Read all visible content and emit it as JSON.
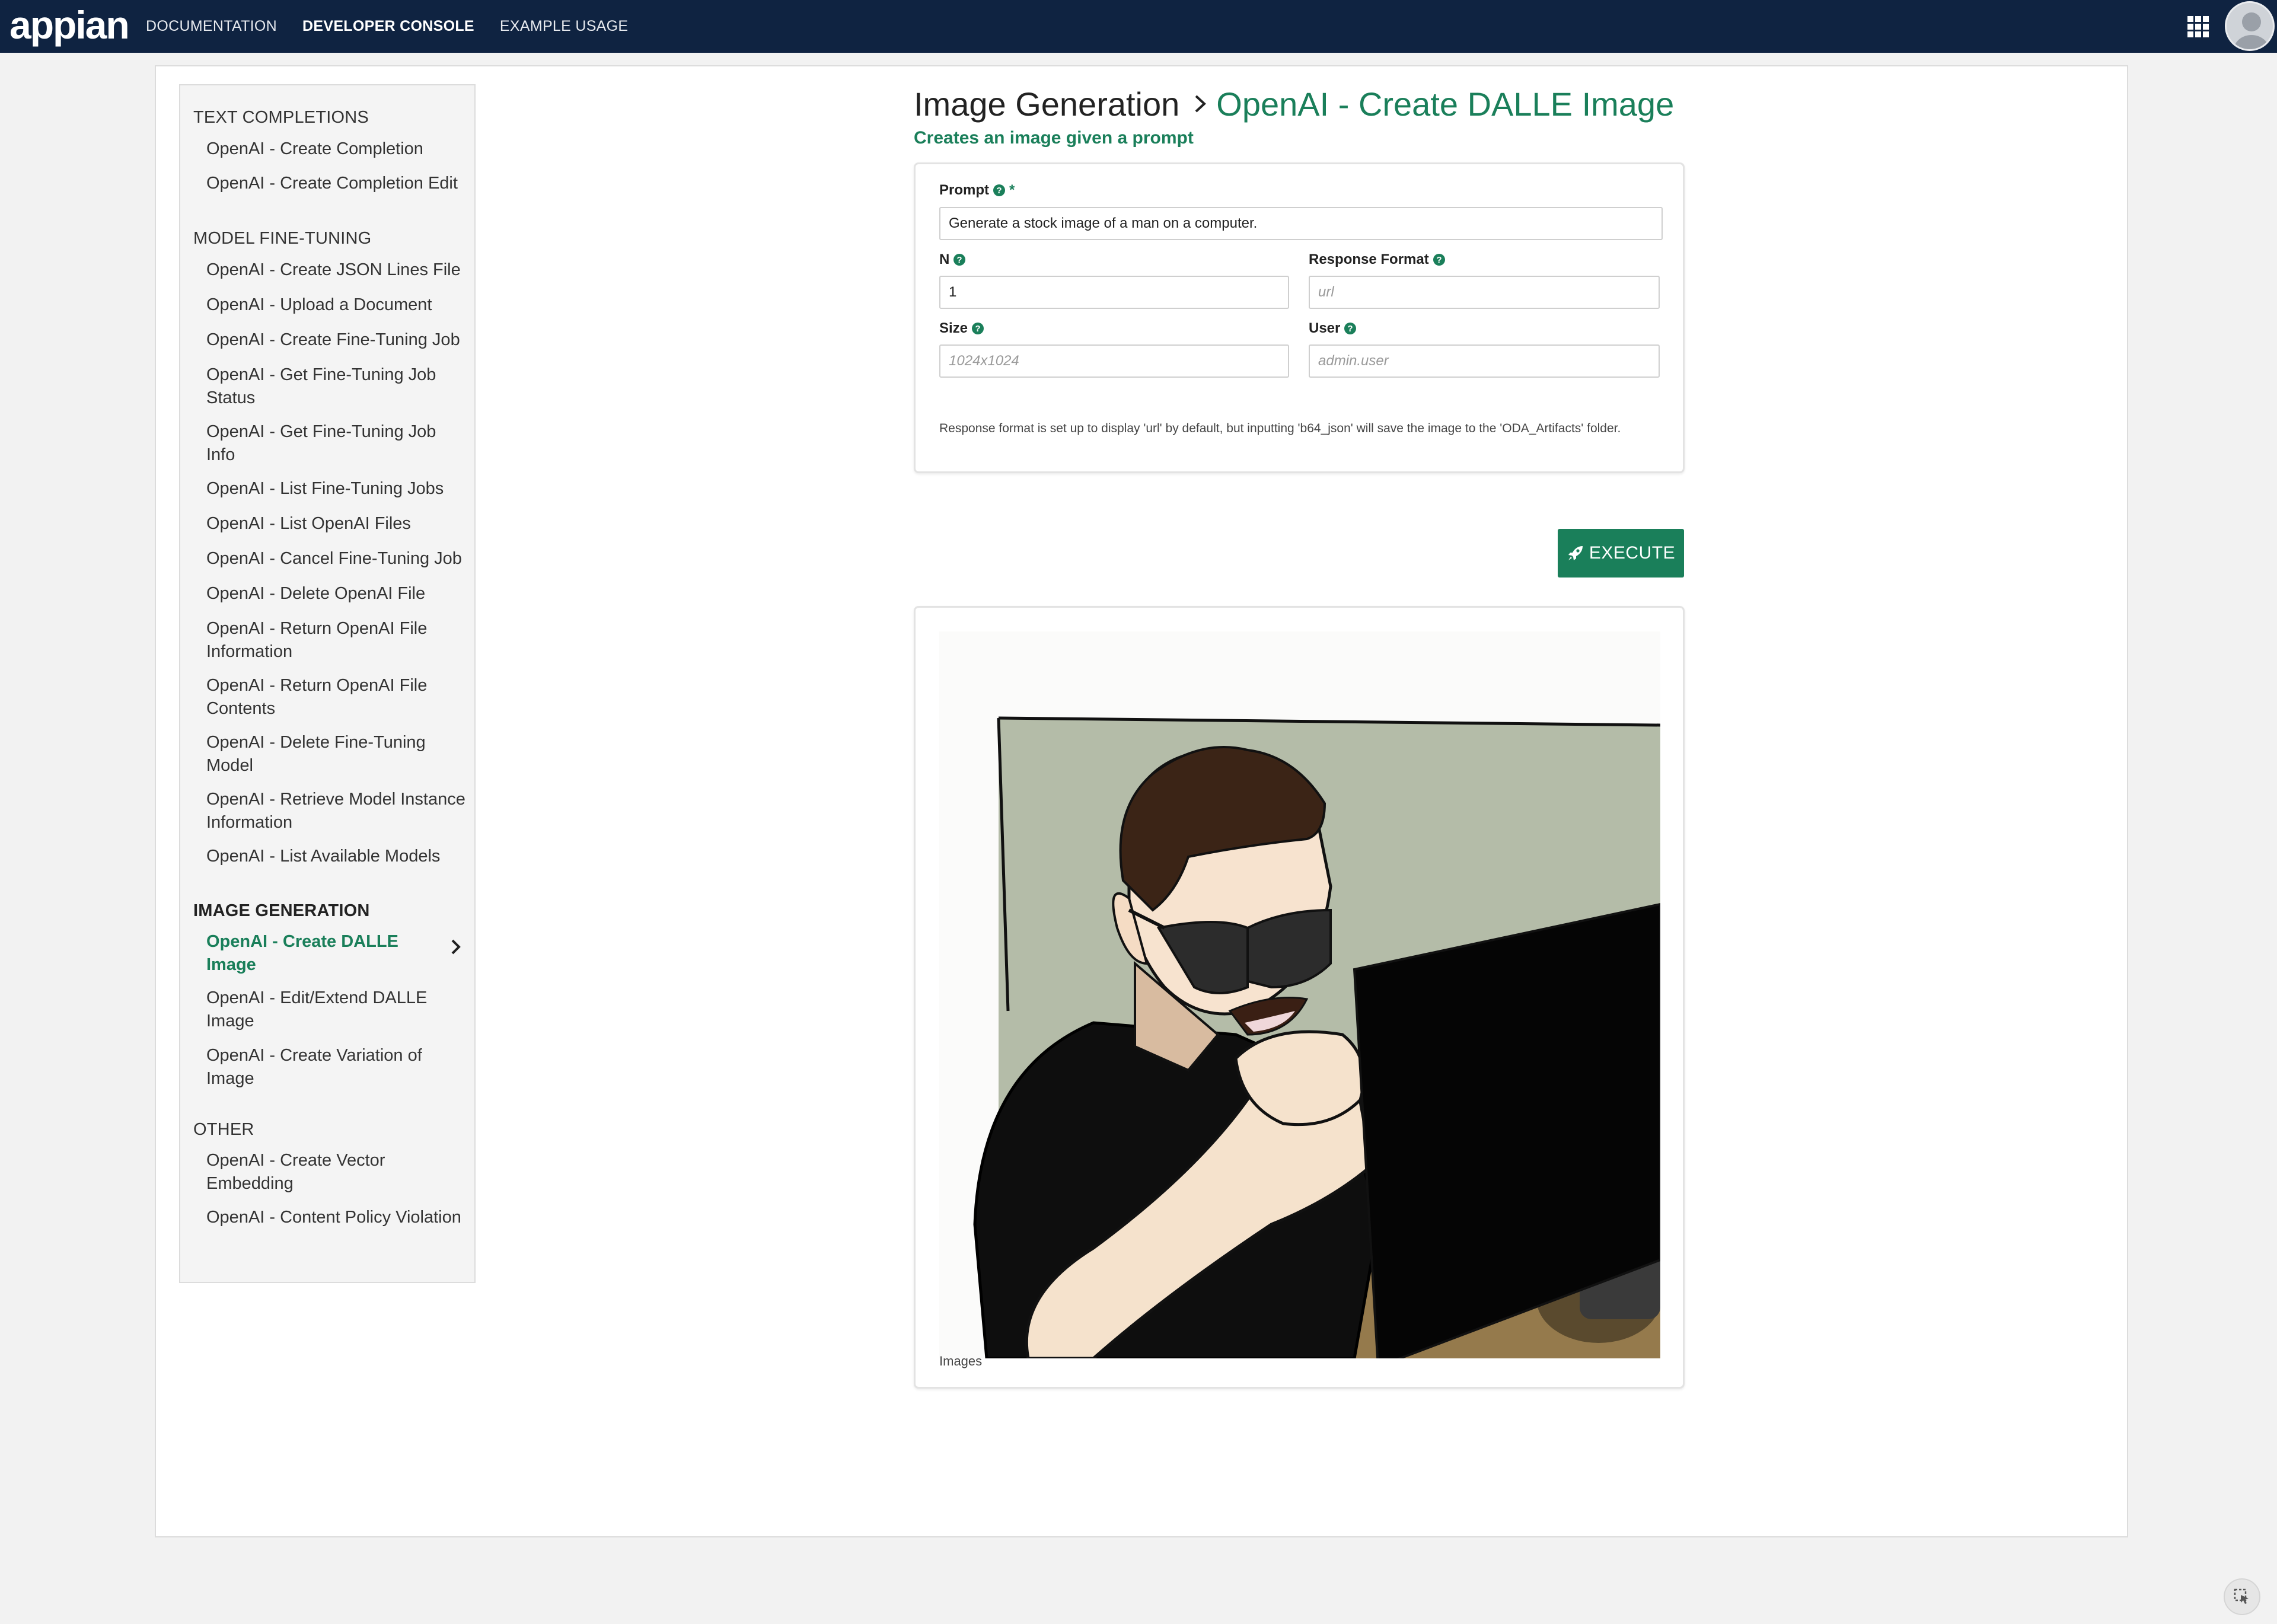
{
  "app": {
    "logo": "appian",
    "nav": [
      {
        "label": "DOCUMENTATION"
      },
      {
        "label": "DEVELOPER CONSOLE"
      },
      {
        "label": "EXAMPLE USAGE"
      }
    ]
  },
  "sidebar": {
    "sections": [
      {
        "header": "TEXT COMPLETIONS",
        "items": [
          "OpenAI - Create Completion",
          "OpenAI - Create Completion Edit"
        ]
      },
      {
        "header": "MODEL FINE-TUNING",
        "items": [
          "OpenAI - Create JSON Lines File",
          "OpenAI - Upload a Document",
          "OpenAI - Create Fine-Tuning Job",
          "OpenAI - Get Fine-Tuning Job Status",
          "OpenAI - Get Fine-Tuning Job Info",
          "OpenAI - List Fine-Tuning Jobs",
          "OpenAI - List OpenAI Files",
          "OpenAI - Cancel Fine-Tuning Job",
          "OpenAI - Delete OpenAI File",
          "OpenAI - Return OpenAI File Information",
          "OpenAI - Return OpenAI File Contents",
          "OpenAI - Delete Fine-Tuning Model",
          "OpenAI - Retrieve Model Instance Information",
          "OpenAI - List Available Models"
        ]
      },
      {
        "header": "IMAGE GENERATION",
        "items": [
          "OpenAI - Create DALLE Image",
          "OpenAI - Edit/Extend DALLE Image",
          "OpenAI - Create Variation of Image"
        ]
      },
      {
        "header": "OTHER",
        "items": [
          "OpenAI - Create Vector Embedding",
          "OpenAI - Content Policy Violation"
        ]
      }
    ]
  },
  "content": {
    "breadcrumb_parent": "Image Generation",
    "title": "OpenAI - Create DALLE Image",
    "subtitle": "Creates an image given a prompt",
    "form": {
      "prompt_label": "Prompt",
      "prompt_required": "*",
      "prompt_value": "Generate a stock image of a man on a computer.",
      "n_label": "N",
      "n_value": "1",
      "response_format_label": "Response Format",
      "response_format_placeholder": "url",
      "size_label": "Size",
      "size_placeholder": "1024x1024",
      "user_label": "User",
      "user_placeholder": "admin.user",
      "note": "Response format is set up to display 'url' by default, but inputting 'b64_json' will save the image to the 'ODA_Artifacts' folder."
    },
    "execute_label": "EXECUTE",
    "image_caption": "Images"
  },
  "colors": {
    "topbar": "#0f2341",
    "accent": "#1a7f5a"
  }
}
